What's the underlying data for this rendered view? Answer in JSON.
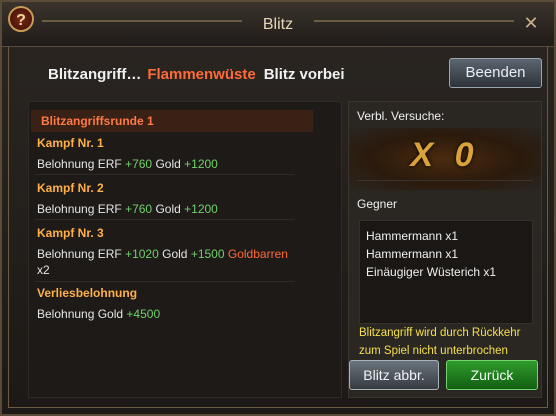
{
  "window": {
    "title": "Blitz",
    "help_label": "?",
    "close_label": "✕"
  },
  "status": {
    "prefix": "Blitzangriff…",
    "location": "Flammenwüste",
    "suffix": "Blitz vorbei"
  },
  "buttons": {
    "end": "Beenden",
    "abort": "Blitz abbr.",
    "back": "Zurück"
  },
  "left_panel": {
    "header": "Blitzangriffsrunde 1",
    "fights": [
      {
        "title": "Kampf Nr. 1",
        "reward_prefix": "Belohnung ERF",
        "erf": "+760",
        "gold_label": "Gold",
        "gold": "+1200"
      },
      {
        "title": "Kampf Nr. 2",
        "reward_prefix": "Belohnung ERF",
        "erf": "+760",
        "gold_label": "Gold",
        "gold": "+1200"
      },
      {
        "title": "Kampf Nr. 3",
        "reward_prefix": "Belohnung ERF",
        "erf": "+1020",
        "gold_label": "Gold",
        "gold": "+1500",
        "bar_label": "Goldbarren",
        "bar_count": "x2"
      }
    ],
    "dungeon": {
      "title": "Verliesbelohnung",
      "reward_prefix": "Belohnung Gold",
      "gold": "+4500"
    }
  },
  "right_panel": {
    "tries_label": "Verbl. Versuche:",
    "tries_value": "X  0",
    "enemies_label": "Gegner",
    "enemies": [
      "Hammermann x1",
      "Hammermann x1",
      "Einäugiger Wüsterich x1"
    ],
    "notice": "Blitzangriff wird durch Rückkehr zum Spiel nicht unterbrochen"
  },
  "colors": {
    "accent_orange": "#ff6a3a",
    "gold_text": "#ffb04a",
    "green": "#71d06b",
    "notice_yellow": "#f4e04a"
  }
}
